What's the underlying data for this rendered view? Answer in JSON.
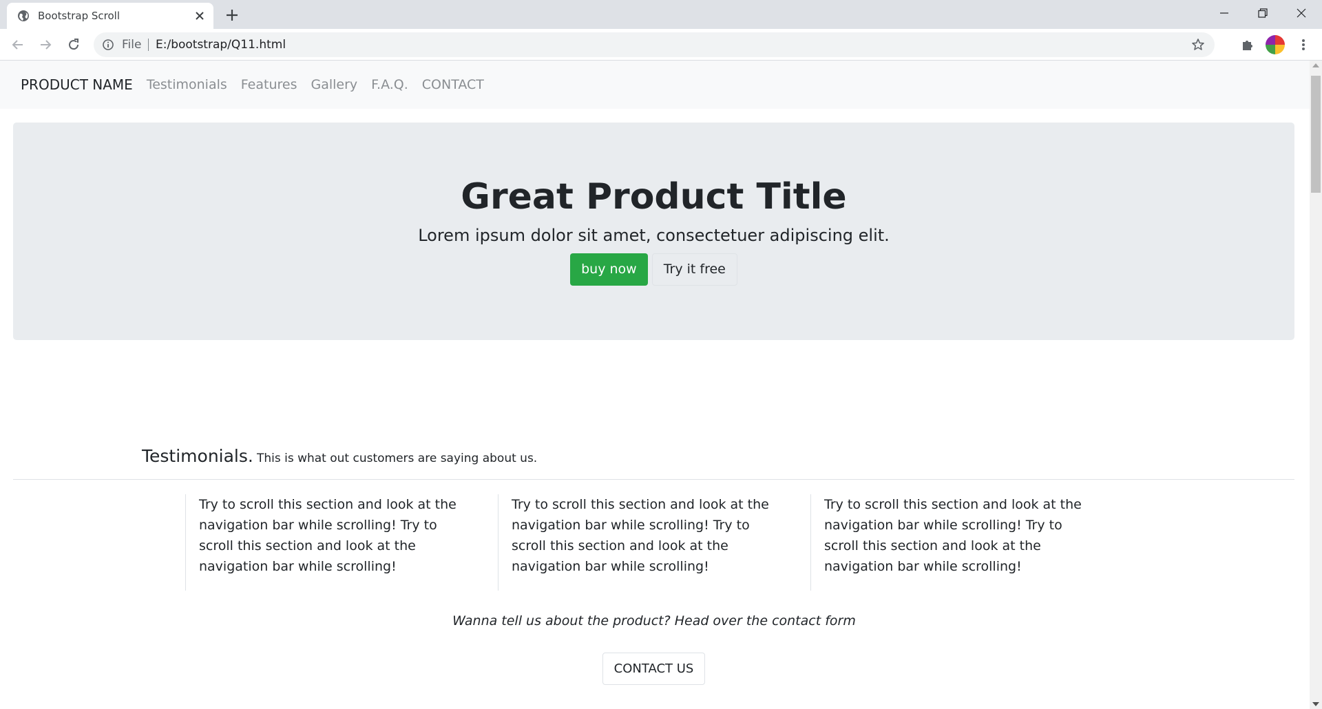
{
  "browser": {
    "tab_title": "Bootstrap Scroll",
    "omnibox_scheme": "File",
    "url": "E:/bootstrap/Q11.html"
  },
  "navbar": {
    "brand": "PRODUCT NAME",
    "links": [
      "Testimonials",
      "Features",
      "Gallery",
      "F.A.Q.",
      "CONTACT"
    ]
  },
  "hero": {
    "title": "Great Product Title",
    "lead": "Lorem ipsum dolor sit amet, consectetuer adipiscing elit.",
    "buy_label": "buy now",
    "try_label": "Try it free",
    "buy_color": "#28a745"
  },
  "testimonials": {
    "title": "Testimonials.",
    "subtitle": "This is what out customers are saying about us.",
    "items": [
      "Try to scroll this section and look at the navigation bar while scrolling! Try to scroll this section and look at the navigation bar while scrolling!",
      "Try to scroll this section and look at the navigation bar while scrolling! Try to scroll this section and look at the navigation bar while scrolling!",
      "Try to scroll this section and look at the navigation bar while scrolling! Try to scroll this section and look at the navigation bar while scrolling!"
    ]
  },
  "cta": {
    "text": "Wanna tell us about the product? Head over the contact form",
    "button_label": "CONTACT US"
  }
}
